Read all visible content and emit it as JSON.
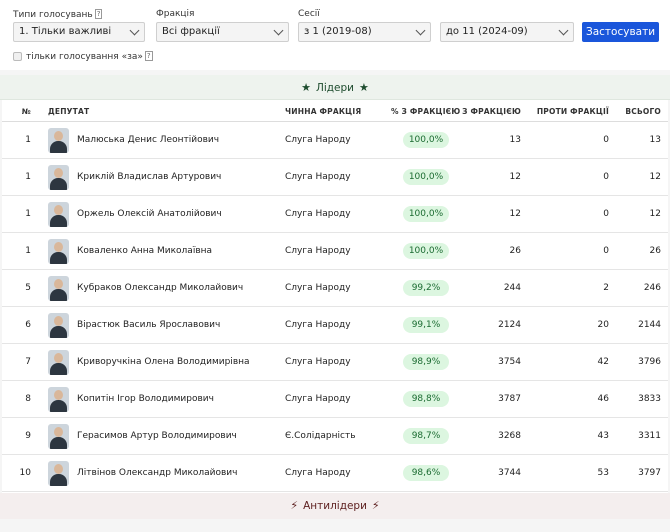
{
  "filters": {
    "vote_types_label": "Типи голосувань",
    "vote_types_help": "?",
    "vote_types_value": "1. Тільки важливі",
    "faction_label": "Фракція",
    "faction_value": "Всі фракції",
    "sessions_label": "Сесії",
    "session_from": "з 1 (2019-08)",
    "session_to": "до 11 (2024-09)",
    "apply_label": "Застосувати",
    "only_for_label": "тільки голосування «за»",
    "only_for_help": "?"
  },
  "leaders": {
    "title": "Лідери",
    "icon": "star-icon"
  },
  "antileaders": {
    "title": "Антилідери",
    "icon": "lightning-icon"
  },
  "table": {
    "headers": {
      "rank": "№",
      "deputy": "ДЕПУТАТ",
      "faction": "ЧИННА ФРАКЦІЯ",
      "pct": "% З ФРАКЦІЄЮ",
      "with": "З ФРАКЦІЄЮ",
      "against": "ПРОТИ ФРАКЦІЇ",
      "total": "ВСЬОГО"
    },
    "rows": [
      {
        "rank": "1",
        "name": "Малюська Денис Леонтійович",
        "faction": "Слуга Народу",
        "pct": "100,0%",
        "with": "13",
        "against": "0",
        "total": "13"
      },
      {
        "rank": "1",
        "name": "Криклій Владислав Артурович",
        "faction": "Слуга Народу",
        "pct": "100,0%",
        "with": "12",
        "against": "0",
        "total": "12"
      },
      {
        "rank": "1",
        "name": "Оржель Олексій Анатолійович",
        "faction": "Слуга Народу",
        "pct": "100,0%",
        "with": "12",
        "against": "0",
        "total": "12"
      },
      {
        "rank": "1",
        "name": "Коваленко Анна Миколаївна",
        "faction": "Слуга Народу",
        "pct": "100,0%",
        "with": "26",
        "against": "0",
        "total": "26"
      },
      {
        "rank": "5",
        "name": "Кубраков Олександр Миколайович",
        "faction": "Слуга Народу",
        "pct": "99,2%",
        "with": "244",
        "against": "2",
        "total": "246"
      },
      {
        "rank": "6",
        "name": "Вірастюк Василь Ярославович",
        "faction": "Слуга Народу",
        "pct": "99,1%",
        "with": "2124",
        "against": "20",
        "total": "2144"
      },
      {
        "rank": "7",
        "name": "Криворучкіна Олена Володимирівна",
        "faction": "Слуга Народу",
        "pct": "98,9%",
        "with": "3754",
        "against": "42",
        "total": "3796"
      },
      {
        "rank": "8",
        "name": "Копитін Ігор Володимирович",
        "faction": "Слуга Народу",
        "pct": "98,8%",
        "with": "3787",
        "against": "46",
        "total": "3833"
      },
      {
        "rank": "9",
        "name": "Герасимов Артур Володимирович",
        "faction": "Є.Солідарність",
        "pct": "98,7%",
        "with": "3268",
        "against": "43",
        "total": "3311"
      },
      {
        "rank": "10",
        "name": "Літвінов Олександр Миколайович",
        "faction": "Слуга Народу",
        "pct": "98,6%",
        "with": "3744",
        "against": "53",
        "total": "3797"
      }
    ]
  },
  "colors": {
    "apply_button": "#1a56db",
    "leaders_bg": "#eef3ee",
    "antileaders_bg": "#f4eeee",
    "pct_badge_bg": "#dcf6e0",
    "pct_badge_text": "#1b6b31"
  }
}
